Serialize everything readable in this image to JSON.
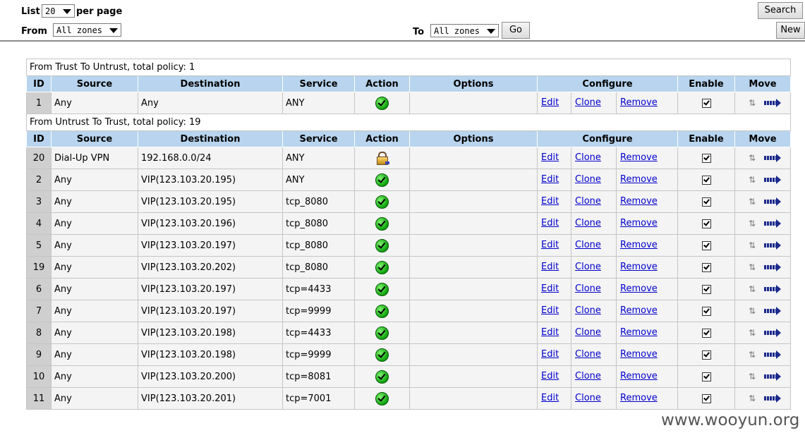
{
  "controls": {
    "list_label": "List",
    "list_value": "20",
    "per_page_label": "per page",
    "from_label": "From",
    "from_value": "All zones",
    "to_label": "To",
    "to_value": "All zones",
    "go_label": "Go",
    "search_label": "Search",
    "new_label": "New"
  },
  "columns": [
    "ID",
    "Source",
    "Destination",
    "Service",
    "Action",
    "Options",
    "Configure",
    "Enable",
    "Move"
  ],
  "links": {
    "edit": "Edit",
    "clone": "Clone",
    "remove": "Remove"
  },
  "groups": [
    {
      "title": "From Trust To Untrust, total policy: 1",
      "policies": [
        {
          "id": "1",
          "source": "Any",
          "destination": "Any",
          "service": "ANY",
          "action": "permit",
          "enabled": true
        }
      ]
    },
    {
      "title": "From Untrust To Trust, total policy: 19",
      "policies": [
        {
          "id": "20",
          "source": "Dial-Up VPN",
          "destination": "192.168.0.0/24",
          "service": "ANY",
          "action": "tunnel",
          "enabled": true
        },
        {
          "id": "2",
          "source": "Any",
          "destination": "VIP(123.103.20.195)",
          "service": "ANY",
          "action": "permit",
          "enabled": true
        },
        {
          "id": "3",
          "source": "Any",
          "destination": "VIP(123.103.20.195)",
          "service": "tcp_8080",
          "action": "permit",
          "enabled": true
        },
        {
          "id": "4",
          "source": "Any",
          "destination": "VIP(123.103.20.196)",
          "service": "tcp_8080",
          "action": "permit",
          "enabled": true
        },
        {
          "id": "5",
          "source": "Any",
          "destination": "VIP(123.103.20.197)",
          "service": "tcp_8080",
          "action": "permit",
          "enabled": true
        },
        {
          "id": "19",
          "source": "Any",
          "destination": "VIP(123.103.20.202)",
          "service": "tcp_8080",
          "action": "permit",
          "enabled": true
        },
        {
          "id": "6",
          "source": "Any",
          "destination": "VIP(123.103.20.197)",
          "service": "tcp=4433",
          "action": "permit",
          "enabled": true
        },
        {
          "id": "7",
          "source": "Any",
          "destination": "VIP(123.103.20.197)",
          "service": "tcp=9999",
          "action": "permit",
          "enabled": true
        },
        {
          "id": "8",
          "source": "Any",
          "destination": "VIP(123.103.20.198)",
          "service": "tcp=4433",
          "action": "permit",
          "enabled": true
        },
        {
          "id": "9",
          "source": "Any",
          "destination": "VIP(123.103.20.198)",
          "service": "tcp=9999",
          "action": "permit",
          "enabled": true
        },
        {
          "id": "10",
          "source": "Any",
          "destination": "VIP(123.103.20.200)",
          "service": "tcp=8081",
          "action": "permit",
          "enabled": true
        },
        {
          "id": "11",
          "source": "Any",
          "destination": "VIP(123.103.20.201)",
          "service": "tcp=7001",
          "action": "permit",
          "enabled": true
        }
      ]
    }
  ],
  "watermark": "www.wooyun.org",
  "icons": {
    "permit": "check-circle-icon",
    "tunnel": "lock-icon",
    "move": "move-arrow-icon",
    "reorder": "refresh-icon"
  },
  "colors": {
    "header_bg": "#b8d4ee",
    "id_bg": "#cfcfcf",
    "row_bg": "#f4f4f4",
    "link": "#0000cc"
  }
}
